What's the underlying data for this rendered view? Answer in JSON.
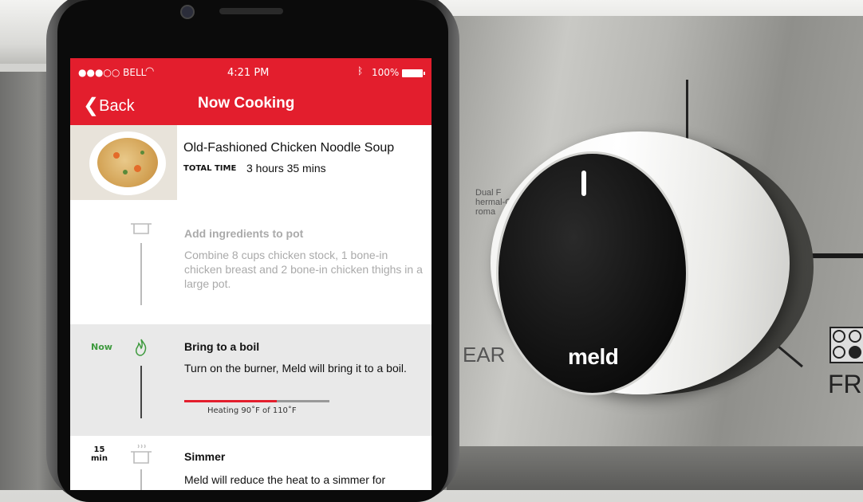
{
  "status_bar": {
    "carrier": "●●●○○ BELL",
    "time": "4:21 PM",
    "battery": "100%"
  },
  "nav": {
    "back_label": "Back",
    "title": "Now Cooking"
  },
  "recipe": {
    "name": "Old-Fashioned Chicken Noodle Soup",
    "total_time_label": "TOTAL TIME",
    "total_time": "3 hours 35 mins"
  },
  "steps": [
    {
      "title": "Add ingredients to pot",
      "description": "Combine 8 cups chicken stock, 1 bone-in chicken breast and 2 bone-in chicken thighs in a large pot.",
      "state": "done"
    },
    {
      "status": "Now",
      "title": "Bring to a boil",
      "description": "Turn on the burner, Meld will bring it to a boil.",
      "progress_text": "Heating 90˚F of 110˚F",
      "progress": 0.64,
      "state": "active"
    },
    {
      "status_line1": "15",
      "status_line2": "min",
      "title": "Simmer",
      "description": "Meld will reduce the heat to a simmer for",
      "state": "pending"
    }
  ],
  "knob": {
    "logo": "meld"
  },
  "stove_labels": {
    "ear": "EAR",
    "fr": "FR",
    "dual": "Dual F\nhermal-C\nroma"
  },
  "colors": {
    "accent": "#e31e2d",
    "now_green": "#3e9a3e"
  },
  "icons": {
    "pot": "pot-icon",
    "flame": "flame-icon",
    "steam_pot": "steaming-pot-icon"
  }
}
